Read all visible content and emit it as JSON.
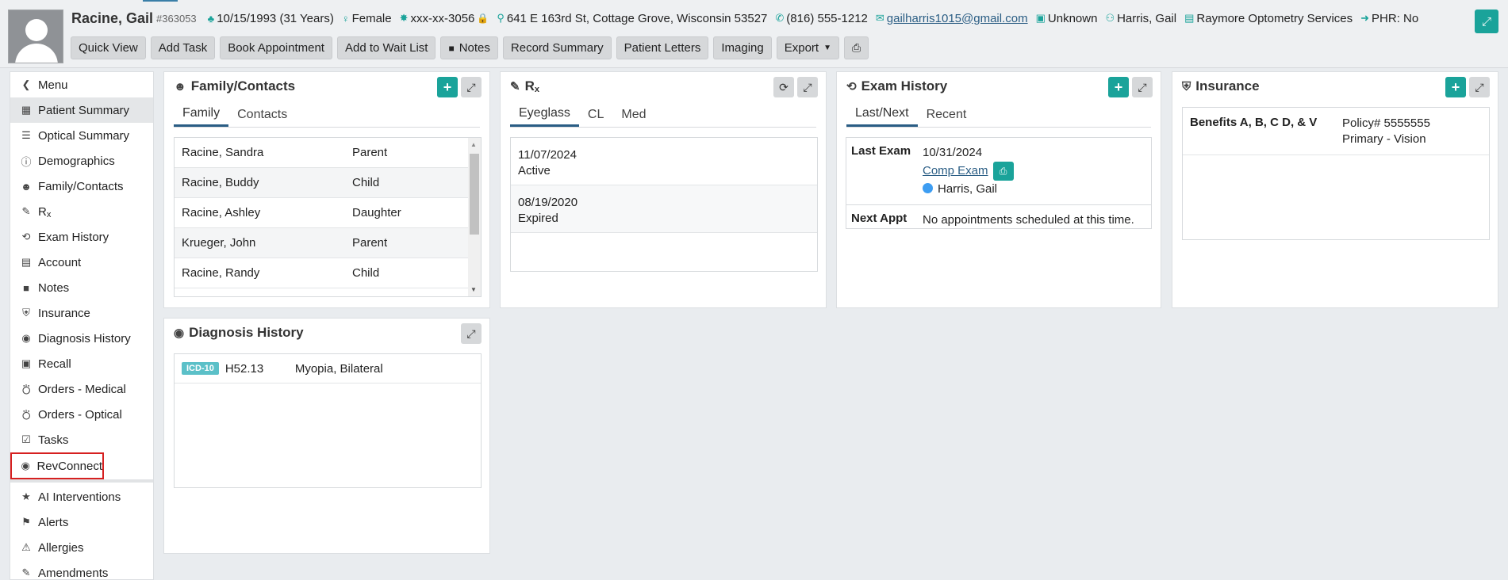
{
  "patient": {
    "name": "Racine, Gail",
    "id": "#363053",
    "dob": "10/15/1993 (31 Years)",
    "sex": "Female",
    "ssn": "xxx-xx-3056",
    "address": "641 E 163rd St, Cottage Grove, Wisconsin 53527",
    "phone": "(816) 555-1212",
    "email": "gailharris1015@gmail.com",
    "employment": "Unknown",
    "provider": "Harris, Gail",
    "location": "Raymore Optometry Services",
    "phr": "PHR: No"
  },
  "toolbar": {
    "quick_view": "Quick View",
    "add_task": "Add Task",
    "book_appointment": "Book Appointment",
    "add_to_wait_list": "Add to Wait List",
    "notes": "Notes",
    "record_summary": "Record Summary",
    "patient_letters": "Patient Letters",
    "imaging": "Imaging",
    "export": "Export"
  },
  "sidebar": {
    "items": [
      {
        "label": "Menu",
        "icon": "chevron-left-icon"
      },
      {
        "label": "Patient Summary",
        "icon": "grid-icon"
      },
      {
        "label": "Optical Summary",
        "icon": "list-icon"
      },
      {
        "label": "Demographics",
        "icon": "info-icon"
      },
      {
        "label": "Family/Contacts",
        "icon": "users-icon"
      },
      {
        "label": "R",
        "sub": "x",
        "icon": "edit-icon"
      },
      {
        "label": "Exam History",
        "icon": "history-icon"
      },
      {
        "label": "Account",
        "icon": "money-icon"
      },
      {
        "label": "Notes",
        "icon": "note-icon"
      },
      {
        "label": "Insurance",
        "icon": "shield-icon"
      },
      {
        "label": "Diagnosis History",
        "icon": "eye-icon"
      },
      {
        "label": "Recall",
        "icon": "calendar-plus-icon"
      },
      {
        "label": "Orders - Medical",
        "icon": "cart-icon"
      },
      {
        "label": "Orders - Optical",
        "icon": "cart-icon"
      },
      {
        "label": "Tasks",
        "icon": "check-square-icon"
      },
      {
        "label": "RevConnect",
        "icon": "chat-icon"
      },
      {
        "label": "AI Interventions",
        "icon": "star-icon"
      },
      {
        "label": "Alerts",
        "icon": "flag-icon"
      },
      {
        "label": "Allergies",
        "icon": "warning-icon"
      },
      {
        "label": "Amendments",
        "icon": "pencil-square-icon"
      }
    ]
  },
  "family_panel": {
    "title": "Family/Contacts",
    "tabs": [
      "Family",
      "Contacts"
    ],
    "rows": [
      {
        "name": "Racine, Sandra",
        "relation": "Parent"
      },
      {
        "name": "Racine, Buddy",
        "relation": "Child"
      },
      {
        "name": "Racine, Ashley",
        "relation": "Daughter"
      },
      {
        "name": "Krueger, John",
        "relation": "Parent"
      },
      {
        "name": "Racine, Randy",
        "relation": "Child"
      }
    ]
  },
  "rx_panel": {
    "title": "R",
    "title_sub": "x",
    "tabs": [
      "Eyeglass",
      "CL",
      "Med"
    ],
    "rows": [
      {
        "date": "11/07/2024",
        "status": "Active"
      },
      {
        "date": "08/19/2020",
        "status": "Expired"
      }
    ]
  },
  "exam_panel": {
    "title": "Exam History",
    "tabs": [
      "Last/Next",
      "Recent"
    ],
    "last_exam_label": "Last Exam",
    "last_exam_date": "10/31/2024",
    "last_exam_type": "Comp Exam",
    "last_exam_provider": "Harris, Gail",
    "next_appt_label": "Next Appt",
    "next_appt_value": "No appointments scheduled at this time."
  },
  "insurance_panel": {
    "title": "Insurance",
    "benefits": "Benefits A, B, C D, & V",
    "policy": "Policy# 5555555",
    "coverage": "Primary - Vision"
  },
  "diagnosis_panel": {
    "title": "Diagnosis History",
    "rows": [
      {
        "badge": "ICD-10",
        "code": "H52.13",
        "desc": "Myopia, Bilateral"
      }
    ]
  },
  "colors": {
    "accent": "#1aa39a",
    "highlight_border": "#d62020",
    "link": "#2a5d84"
  }
}
